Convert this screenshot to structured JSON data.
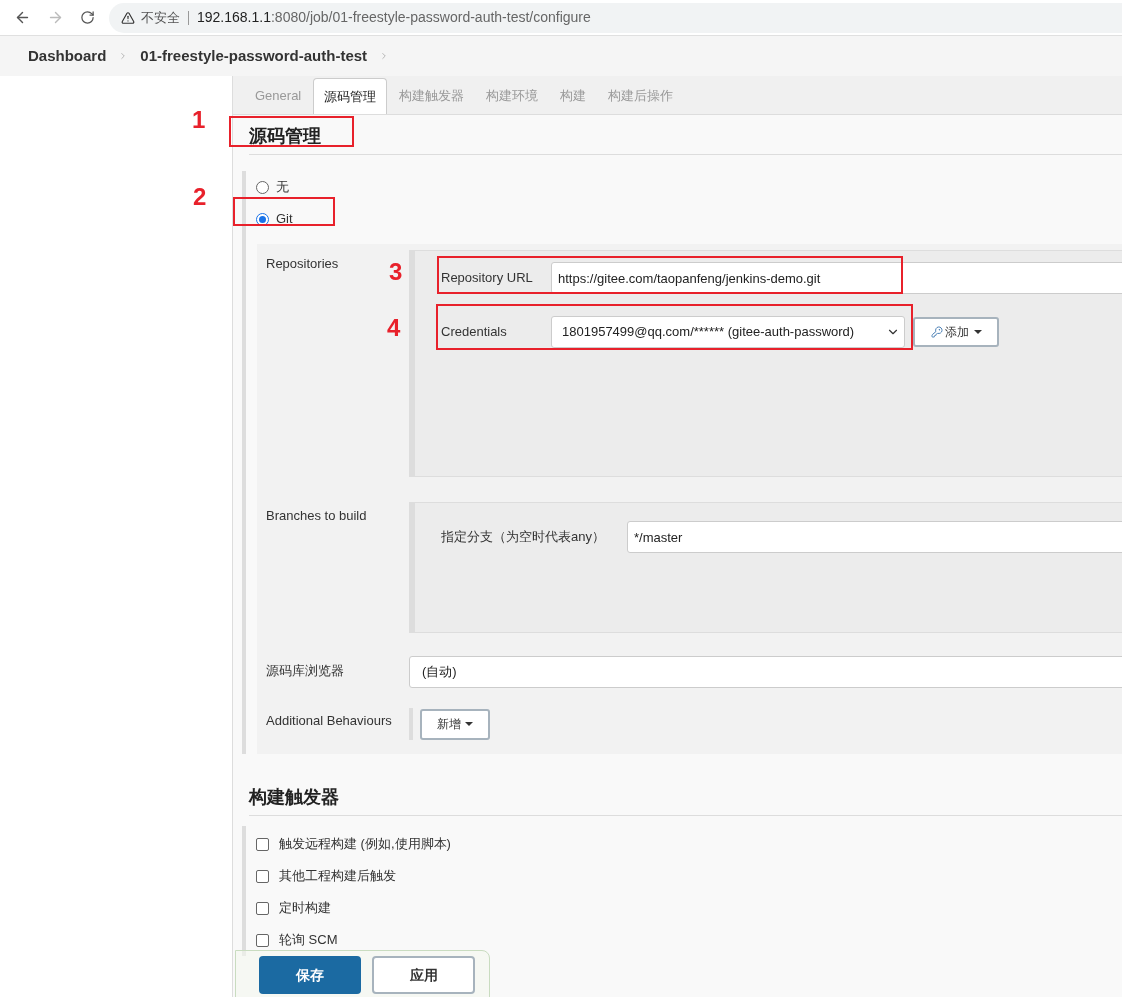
{
  "browser": {
    "security_label": "不安全",
    "url_host": "192.168.1.1",
    "url_path": ":8080/job/01-freestyle-password-auth-test/configure"
  },
  "breadcrumbs": [
    {
      "label": "Dashboard"
    },
    {
      "label": "01-freestyle-password-auth-test"
    }
  ],
  "tabs": [
    {
      "label": "General",
      "selected": false
    },
    {
      "label": "源码管理",
      "selected": true
    },
    {
      "label": "构建触发器",
      "selected": false
    },
    {
      "label": "构建环境",
      "selected": false
    },
    {
      "label": "构建",
      "selected": false
    },
    {
      "label": "构建后操作",
      "selected": false
    }
  ],
  "scm": {
    "heading": "源码管理",
    "options": [
      {
        "label": "无",
        "selected": false
      },
      {
        "label": "Git",
        "selected": true
      }
    ],
    "git": {
      "repositories_label": "Repositories",
      "repository_url_label": "Repository URL",
      "repository_url": "https://gitee.com/taopanfeng/jenkins-demo.git",
      "credentials_label": "Credentials",
      "credentials_value": "1801957499@qq.com/****** (gitee-auth-password)",
      "add_button": "添加",
      "branches_label": "Branches to build",
      "branch_spec_label": "指定分支（为空时代表any）",
      "branch_spec": "*/master",
      "browser_label": "源码库浏览器",
      "browser_value": "(自动)",
      "behaviours_label": "Additional Behaviours",
      "behaviours_button": "新增"
    }
  },
  "triggers": {
    "heading": "构建触发器",
    "options": [
      {
        "label": "触发远程构建 (例如,使用脚本)",
        "checked": false
      },
      {
        "label": "其他工程构建后触发",
        "checked": false
      },
      {
        "label": "定时构建",
        "checked": false
      },
      {
        "label": "轮询 SCM",
        "checked": false
      }
    ]
  },
  "footer": {
    "save": "保存",
    "apply": "应用"
  },
  "annotations": [
    {
      "label": "1"
    },
    {
      "label": "2"
    },
    {
      "label": "3"
    },
    {
      "label": "4"
    }
  ]
}
